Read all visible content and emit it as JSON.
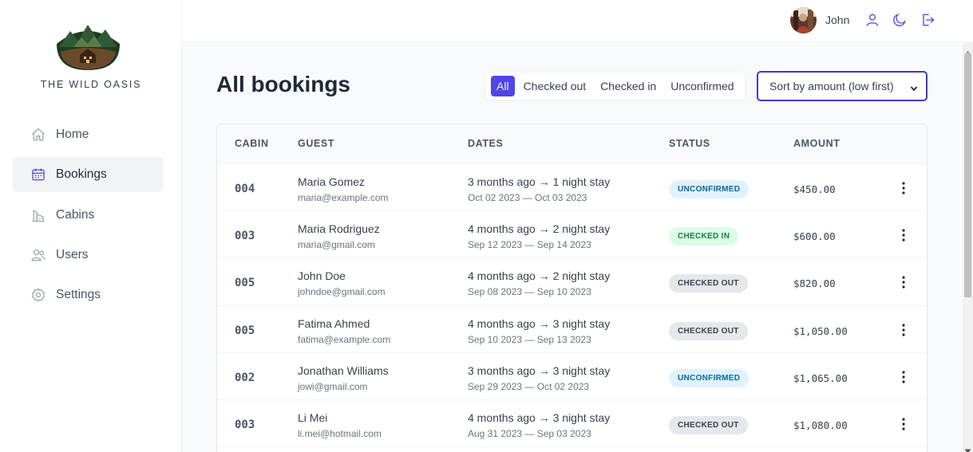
{
  "app": {
    "brand": "THE WILD OASIS",
    "accent_color": "#4f46e5"
  },
  "sidebar": {
    "items": [
      {
        "label": "Home",
        "icon": "home-icon",
        "active": false
      },
      {
        "label": "Bookings",
        "icon": "calendar-icon",
        "active": true
      },
      {
        "label": "Cabins",
        "icon": "cabins-icon",
        "active": false
      },
      {
        "label": "Users",
        "icon": "users-icon",
        "active": false
      },
      {
        "label": "Settings",
        "icon": "gear-icon",
        "active": false
      }
    ]
  },
  "header": {
    "username": "John",
    "icons": [
      "user-icon",
      "moon-icon",
      "logout-icon"
    ]
  },
  "main": {
    "title": "All bookings",
    "filters": [
      {
        "label": "All",
        "active": true
      },
      {
        "label": "Checked out",
        "active": false
      },
      {
        "label": "Checked in",
        "active": false
      },
      {
        "label": "Unconfirmed",
        "active": false
      }
    ],
    "sort_label": "Sort by amount (low first)"
  },
  "table": {
    "headers": {
      "cabin": "CABIN",
      "guest": "GUEST",
      "dates": "DATES",
      "status": "STATUS",
      "amount": "AMOUNT"
    },
    "rows": [
      {
        "cabin": "004",
        "guest": "Maria Gomez",
        "email": "maria@example.com",
        "dates": "3 months ago → 1 night stay",
        "range": "Oct 02 2023 — Oct 03 2023",
        "status": "UNCONFIRMED",
        "amount": "$450.00"
      },
      {
        "cabin": "003",
        "guest": "Maria Rodriguez",
        "email": "maria@gmail.com",
        "dates": "4 months ago → 2 night stay",
        "range": "Sep 12 2023 — Sep 14 2023",
        "status": "CHECKED IN",
        "amount": "$600.00"
      },
      {
        "cabin": "005",
        "guest": "John Doe",
        "email": "johndoe@gmail.com",
        "dates": "4 months ago → 2 night stay",
        "range": "Sep 08 2023 — Sep 10 2023",
        "status": "CHECKED OUT",
        "amount": "$820.00"
      },
      {
        "cabin": "005",
        "guest": "Fatima Ahmed",
        "email": "fatima@example.com",
        "dates": "4 months ago → 3 night stay",
        "range": "Sep 10 2023 — Sep 13 2023",
        "status": "CHECKED OUT",
        "amount": "$1,050.00"
      },
      {
        "cabin": "002",
        "guest": "Jonathan Williams",
        "email": "jowi@gmail.com",
        "dates": "3 months ago → 3 night stay",
        "range": "Sep 29 2023 — Oct 02 2023",
        "status": "UNCONFIRMED",
        "amount": "$1,065.00"
      },
      {
        "cabin": "003",
        "guest": "Li Mei",
        "email": "li.mei@hotmail.com",
        "dates": "4 months ago → 3 night stay",
        "range": "Aug 31 2023 — Sep 03 2023",
        "status": "CHECKED OUT",
        "amount": "$1,080.00"
      }
    ]
  }
}
